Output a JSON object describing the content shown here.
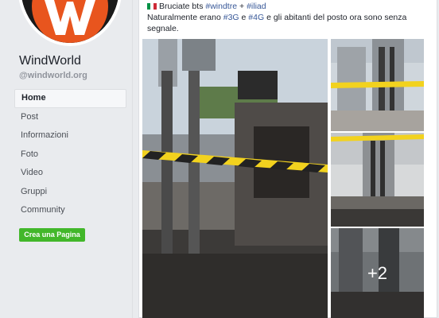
{
  "page": {
    "name": "WindWorld",
    "handle": "@windworld.org"
  },
  "nav": {
    "items": [
      {
        "label": "Home",
        "active": true
      },
      {
        "label": "Post"
      },
      {
        "label": "Informazioni"
      },
      {
        "label": "Foto"
      },
      {
        "label": "Video"
      },
      {
        "label": "Gruppi"
      },
      {
        "label": "Community"
      }
    ],
    "create_label": "Crea una Pagina"
  },
  "post": {
    "line1_prefix": "Bruciate bts",
    "hashtag_windtre": "#windtre",
    "plus": "+",
    "hashtag_iliad": "#iliad",
    "line2_start": "Naturalmente erano",
    "hashtag_3g": "#3G",
    "conj": "e",
    "hashtag_4g": "#4G",
    "line2_end": "e gli abitanti del posto ora sono senza segnale.",
    "more_photos": "+2"
  },
  "colors": {
    "accent_link": "#385898",
    "create_button": "#42b72a",
    "background": "#e9ebee"
  }
}
